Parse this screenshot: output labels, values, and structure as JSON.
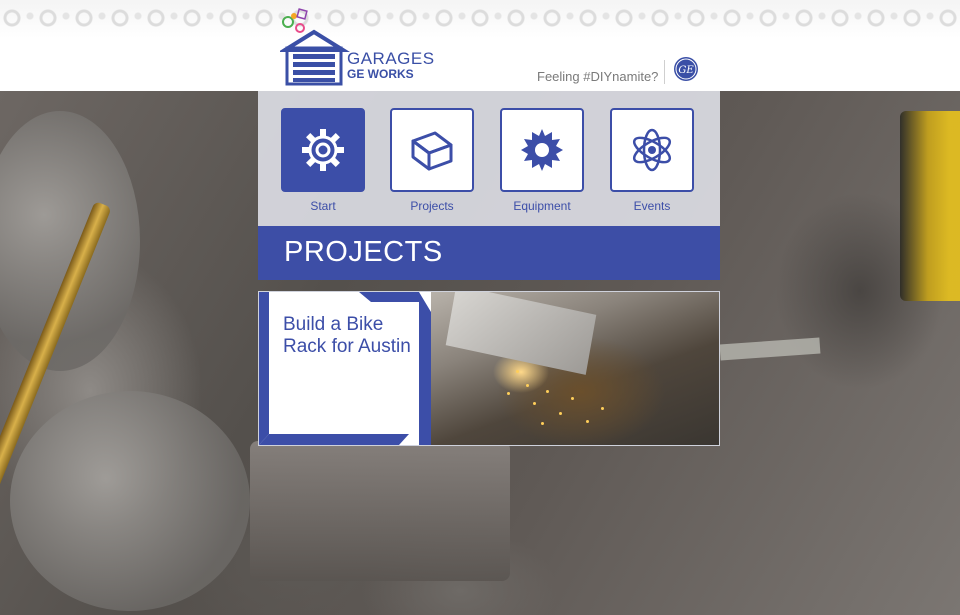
{
  "header": {
    "brand_line1": "GARAGES",
    "brand_line2": "GE WORKS",
    "tagline": "Feeling #DIYnamite?",
    "ge_logo_text": "GE"
  },
  "nav": {
    "items": [
      {
        "label": "Start",
        "icon": "gear-icon",
        "active": true
      },
      {
        "label": "Projects",
        "icon": "cube-icon",
        "active": false
      },
      {
        "label": "Equipment",
        "icon": "cog-badge-icon",
        "active": false
      },
      {
        "label": "Events",
        "icon": "atom-icon",
        "active": false
      }
    ]
  },
  "section": {
    "title": "PROJECTS"
  },
  "cards": [
    {
      "title": "Build a Bike Rack for Austin"
    }
  ],
  "colors": {
    "brand_blue": "#3c4ea8",
    "panel_bg": "#e1e3eb",
    "tagline_gray": "#7a7a7a"
  }
}
